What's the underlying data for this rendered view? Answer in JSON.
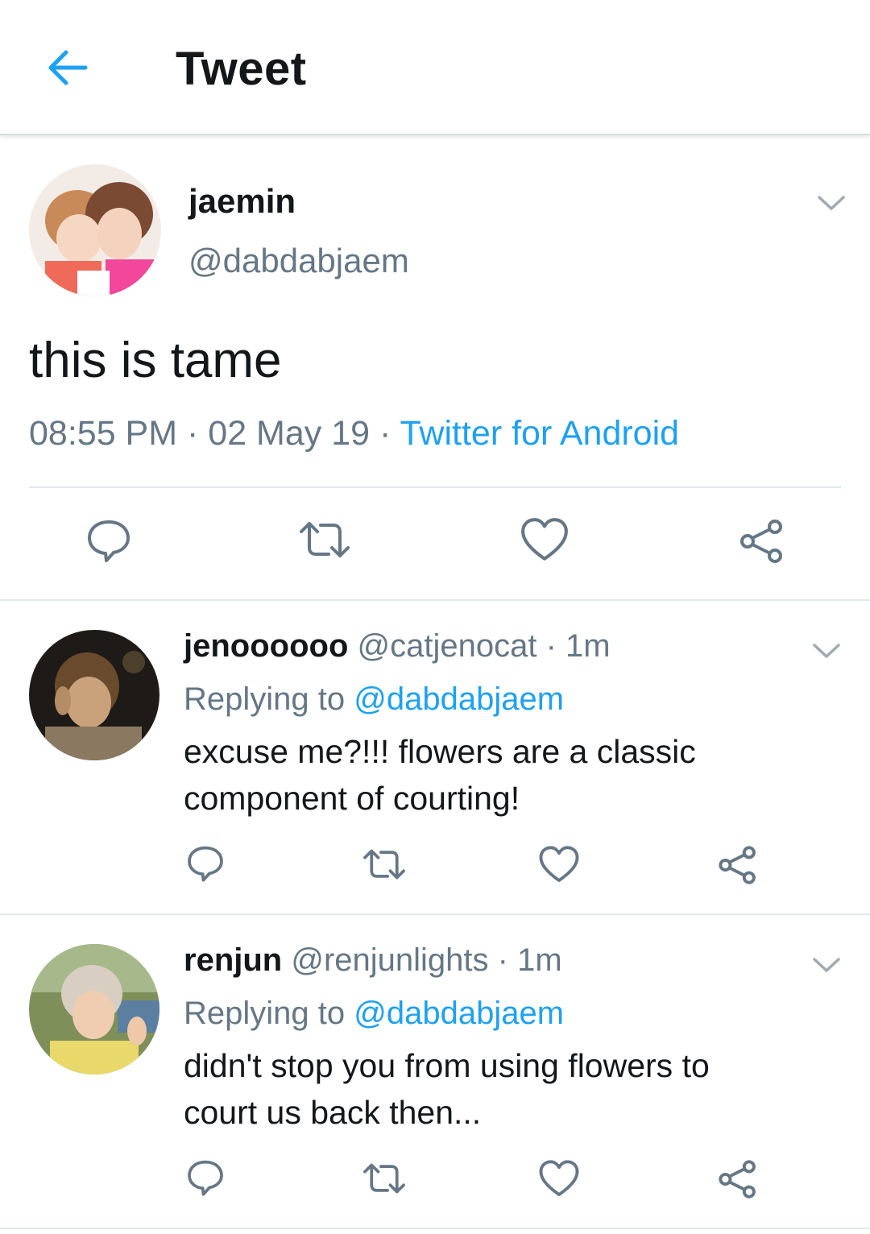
{
  "header": {
    "title": "Tweet"
  },
  "main_tweet": {
    "name": "jaemin",
    "handle": "@dabdabjaem",
    "text": "this is tame",
    "time": "08:55 PM",
    "sep1": " · ",
    "date": "02 May 19",
    "sep2": " · ",
    "source": "Twitter for Android"
  },
  "replies": [
    {
      "name": "jenoooooo",
      "handle": "@catjenocat",
      "time_sep": " · ",
      "time": "1m",
      "replying_label": "Replying to ",
      "replying_to": "@dabdabjaem",
      "text_line1": "excuse me?!!! flowers are a classic",
      "text_line2": "component of courting!"
    },
    {
      "name": "renjun",
      "handle": "@renjunlights",
      "time_sep": " · ",
      "time": "1m",
      "replying_label": "Replying to ",
      "replying_to": "@dabdabjaem",
      "text_line1": "didn't stop you from using flowers to",
      "text_line2": "court us back then..."
    }
  ],
  "icons": {
    "back": "arrow-left-icon",
    "menu": "chevron-down-icon",
    "reply": "reply-icon",
    "retweet": "retweet-icon",
    "like": "heart-icon",
    "share": "share-icon"
  },
  "colors": {
    "accent": "#1da1f2",
    "secondary_text": "#657786",
    "icon": "#657786"
  }
}
